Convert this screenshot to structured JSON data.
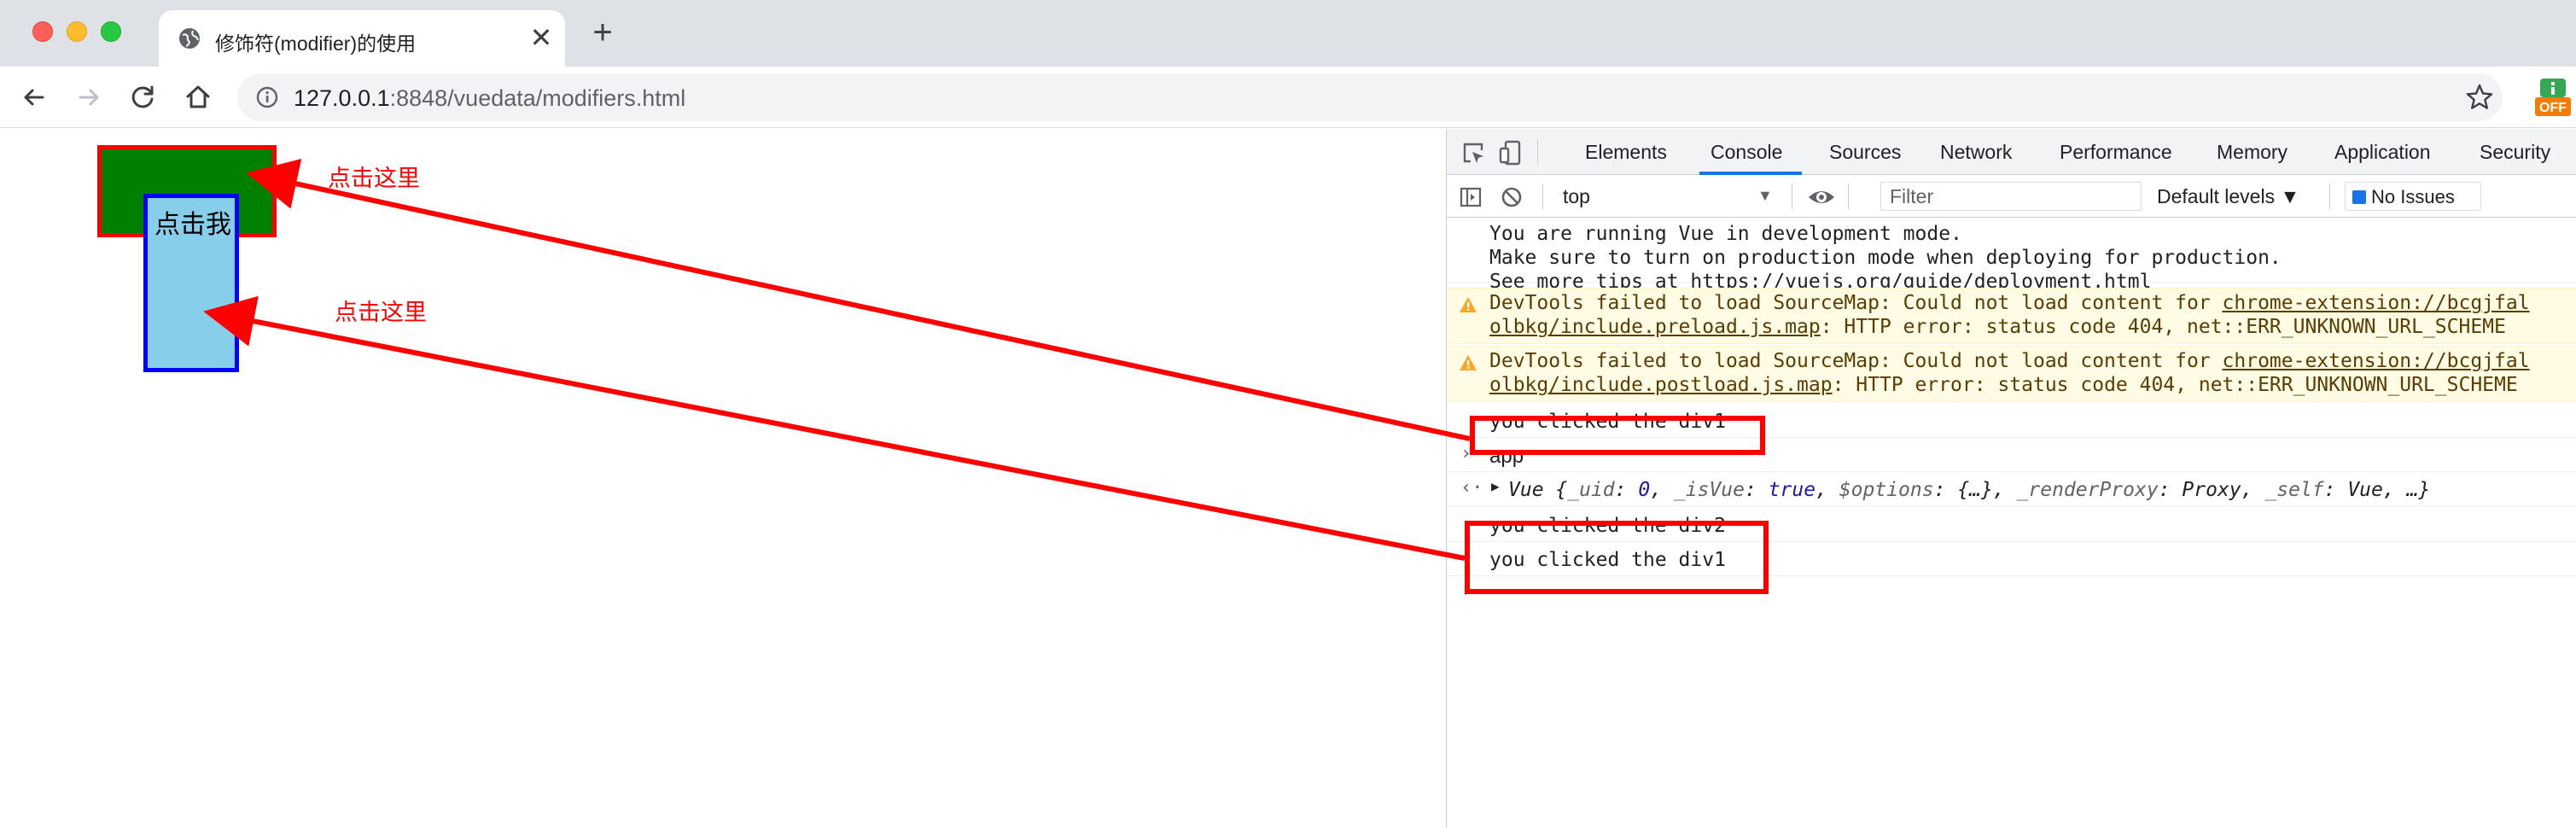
{
  "browser": {
    "tab": {
      "title": "修饰符(modifier)的使用",
      "close_glyph": "✕",
      "favicon": "globe-icon"
    },
    "new_tab_glyph": "+",
    "address": {
      "host": "127.0.0.1",
      "rest": ":8848/vuedata/modifiers.html"
    },
    "extension_badge": "OFF"
  },
  "page": {
    "inner_box_label": "点击我",
    "annotation_1": "点击这里",
    "annotation_2": "点击这里",
    "colors": {
      "outer_fill": "#008000",
      "outer_border": "#ff0000",
      "inner_fill": "#87ceeb",
      "inner_border": "#0000ff",
      "annotation": "#ff0000"
    }
  },
  "devtools": {
    "tabs": [
      "Elements",
      "Console",
      "Sources",
      "Network",
      "Performance",
      "Memory",
      "Application",
      "Security"
    ],
    "active_tab": "Console",
    "filterbar": {
      "context": "top",
      "filter_placeholder": "Filter",
      "levels": "Default levels ▼",
      "issues": "No Issues"
    },
    "console": {
      "info_lines": [
        "You are running Vue in development mode.",
        "Make sure to turn on production mode when deploying for production.",
        "See more tips at "
      ],
      "info_link": "https://vuejs.org/guide/deployment.html",
      "warn1": {
        "prefix": "DevTools failed to load SourceMap: Could not load content for ",
        "link1": "chrome-extension://bcgjfal",
        "link2": "olbkg/include.preload.js.map",
        "suffix": ": HTTP error: status code 404, net::ERR_UNKNOWN_URL_SCHEME"
      },
      "warn2": {
        "prefix": "DevTools failed to load SourceMap: Could not load content for ",
        "link1": "chrome-extension://bcgjfal",
        "link2": "olbkg/include.postload.js.map",
        "suffix": ": HTTP error: status code 404, net::ERR_UNKNOWN_URL_SCHEME"
      },
      "log1": "you clicked the div1",
      "input_cmd": "app",
      "vue_result": {
        "head": "Vue {",
        "uid_key": "_uid",
        "uid_val": "0",
        "isvue_key": "_isVue",
        "isvue_val": "true",
        "options_key": "$options",
        "options_val": "{…}",
        "proxy_key": "_renderProxy",
        "proxy_val": "Proxy",
        "self_key": "_self",
        "self_val": "Vue",
        "tail": "…}"
      },
      "log2": "you clicked the div2",
      "log3": "you clicked the div1"
    }
  }
}
